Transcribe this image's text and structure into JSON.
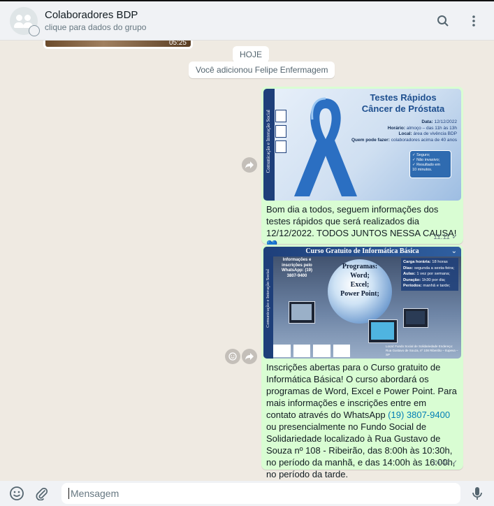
{
  "header": {
    "group_name": "Colaboradores BDP",
    "subtitle": "clique para dados do grupo",
    "icons": [
      "group-avatar-icon",
      "search-icon",
      "menu-dots-icon"
    ]
  },
  "chat": {
    "prev_video_time": "05:25",
    "date_chip": "HOJE",
    "system_message": "Você adicionou Felipe Enfermagem",
    "messages": [
      {
        "image": {
          "side_text": "Comunicação e Interação Social",
          "title_line1": "Testes Rápidos",
          "title_line2": "Câncer de Próstata",
          "details": [
            {
              "label": "Data:",
              "value": "12/12/2022"
            },
            {
              "label": "Horário:",
              "value": "almoço – das 11h às 13h"
            },
            {
              "label": "Local:",
              "value": "área de vivência BDP"
            },
            {
              "label": "Quem pode fazer:",
              "value": "colaboradores acima de 40 anos"
            }
          ],
          "card_lines": [
            "✓ Seguro;",
            "✓ Não invasivo;",
            "✓ Resultado em",
            "10 minutos."
          ]
        },
        "text": "Bom dia a todos, seguem informações dos testes rápidos que será realizados dia 12/12/2022. TODOS JUNTOS NESSA CAUSA! 💙",
        "time": "11:11 ✓"
      },
      {
        "image": {
          "banner": "Curso Gratuito de Informática Básica",
          "side_text": "Comunicação e Interação Social",
          "info": "Informações e inscrições pelo WhatsApp: (19) 3807-9400",
          "programs_label": "Programas:",
          "programs": [
            "Word;",
            "Excel;",
            "Power Point;"
          ],
          "details": [
            {
              "label": "Carga horária:",
              "value": "18 horas"
            },
            {
              "label": "Dias:",
              "value": "segunda a sexta-feira;"
            },
            {
              "label": "Aulas:",
              "value": "1 vez por semana;"
            },
            {
              "label": "Duração:",
              "value": "1h30 por dia;"
            },
            {
              "label": "Períodos:",
              "value": "manhã e tarde;"
            }
          ],
          "address": "Local: Fundo Social de Solidariedade  Endereço: Rua Gustavo de Souza, nº 108 Ribeirão – Itupeva – SP"
        },
        "text_before_link": "Inscrições abertas para o Curso gratuito de Informática Básica!  O curso abordará os programas de Word, Excel e Power Point. Para mais informações e inscrições entre em contato através do WhatsApp ",
        "link": "(19) 3807-9400",
        "text_after_link": " ou presencialmente no Fundo Social de Solidariedade localizado à Rua Gustavo de Souza nº 108 - Ribeirão, das 8:00h às 10:30h, no período da manhã, e das 14:00h às 16:00h, no período da tarde.",
        "time": "14:42 ✓"
      }
    ]
  },
  "footer": {
    "input_placeholder": "Mensagem",
    "icons": [
      "emoji-icon",
      "attach-icon",
      "microphone-icon"
    ]
  },
  "colors": {
    "chat_bg": "#efeae2",
    "outgoing_bubble": "#d9fdd3",
    "header_bg": "#f0f2f5",
    "link": "#027eb5"
  }
}
